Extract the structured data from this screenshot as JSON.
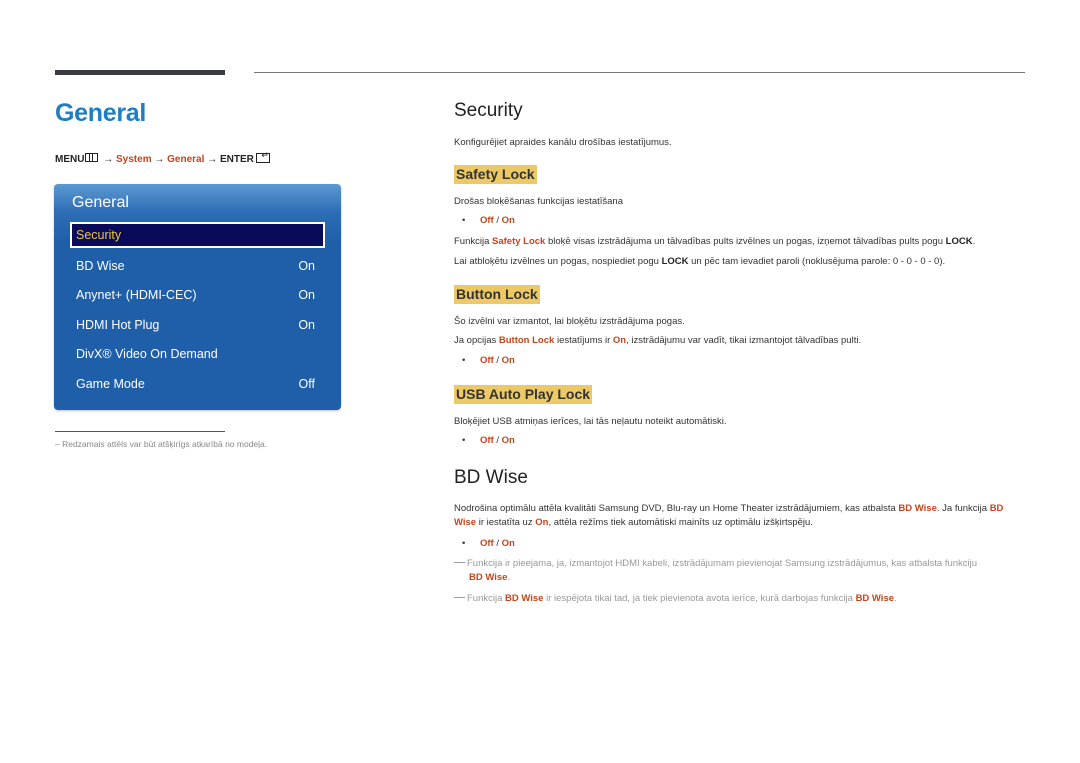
{
  "page": {
    "title": "General",
    "breadcrumb": {
      "menu": "MENU",
      "arrow": "→",
      "system": "System",
      "general": "General",
      "enter": "ENTER"
    }
  },
  "panel": {
    "title": "General",
    "items": [
      {
        "label": "Security",
        "value": "",
        "selected": true
      },
      {
        "label": "BD Wise",
        "value": "On"
      },
      {
        "label": "Anynet+ (HDMI-CEC)",
        "value": "On"
      },
      {
        "label": "HDMI Hot Plug",
        "value": "On"
      },
      {
        "label": "DivX® Video On Demand",
        "value": ""
      },
      {
        "label": "Game Mode",
        "value": "Off"
      }
    ]
  },
  "footnote": "Redzamais attēls var būt atšķirīgs atkarībā no modeļa.",
  "security": {
    "heading": "Security",
    "intro": "Konfigurējiet apraides kanālu drošības iestatījumus.",
    "safety_lock": {
      "heading": "Safety Lock",
      "desc": "Drošas bloķēšanas funkcijas iestatīšana",
      "opt_off": "Off",
      "opt_sep": " / ",
      "opt_on": "On",
      "line1_a": "Funkcija ",
      "line1_hl": "Safety Lock",
      "line1_b": " bloķē visas izstrādājuma un tālvadības pults izvēlnes un pogas, izņemot tālvadības pults pogu ",
      "line1_k": "LOCK",
      "line1_c": ".",
      "line2_a": "Lai atbloķētu izvēlnes un pogas, nospiediet pogu ",
      "line2_k": "LOCK",
      "line2_b": " un pēc tam ievadiet paroli (noklusējuma parole: 0 - 0 - 0 - 0)."
    },
    "button_lock": {
      "heading": "Button Lock",
      "desc": "Šo izvēlni var izmantot, lai bloķētu izstrādājuma pogas.",
      "line_a": "Ja opcijas ",
      "line_hl": "Button Lock",
      "line_b": " iestatījums ir ",
      "line_on": "On",
      "line_c": ", izstrādājumu var vadīt, tikai izmantojot tālvadības pulti.",
      "opt_off": "Off",
      "opt_sep": " / ",
      "opt_on": "On"
    },
    "usb_lock": {
      "heading": "USB Auto Play Lock",
      "desc": "Bloķējiet USB atmiņas ierīces, lai tās neļautu noteikt automātiski.",
      "opt_off": "Off",
      "opt_sep": " / ",
      "opt_on": "On"
    }
  },
  "bdwise": {
    "heading": "BD Wise",
    "p_a": "Nodrošina optimālu attēla kvalitāti Samsung DVD, Blu-ray un Home Theater izstrādājumiem, kas atbalsta ",
    "p_hl1": "BD Wise",
    "p_b": ". Ja funkcija ",
    "p_hl2": "BD Wise",
    "p_c": " ir iestatīta uz ",
    "p_on": "On",
    "p_d": ", attēla režīms tiek automātiski mainīts uz optimālu izšķirtspēju.",
    "opt_off": "Off",
    "opt_sep": " / ",
    "opt_on": "On",
    "note1_a": "Funkcija ir pieejama, ja, izmantojot HDMI kabeli, izstrādājumam pievienojat Samsung izstrādājumus, kas atbalsta funkciju ",
    "note1_hl": "BD Wise",
    "note1_b": ".",
    "note2_a": "Funkcija ",
    "note2_hl1": "BD Wise",
    "note2_b": " ir iespējota tikai tad, ja tiek pievienota avota ierīce, kurā darbojas funkcija ",
    "note2_hl2": "BD Wise",
    "note2_c": "."
  },
  "colors": {
    "title_blue": "#1f7dc1",
    "highlight_orange": "#c4461e",
    "subheading_bg": "#ecc965",
    "panel_blue": "#1f5ea9",
    "selected_bg": "#0a0a5a",
    "selected_text": "#f2c43a"
  }
}
